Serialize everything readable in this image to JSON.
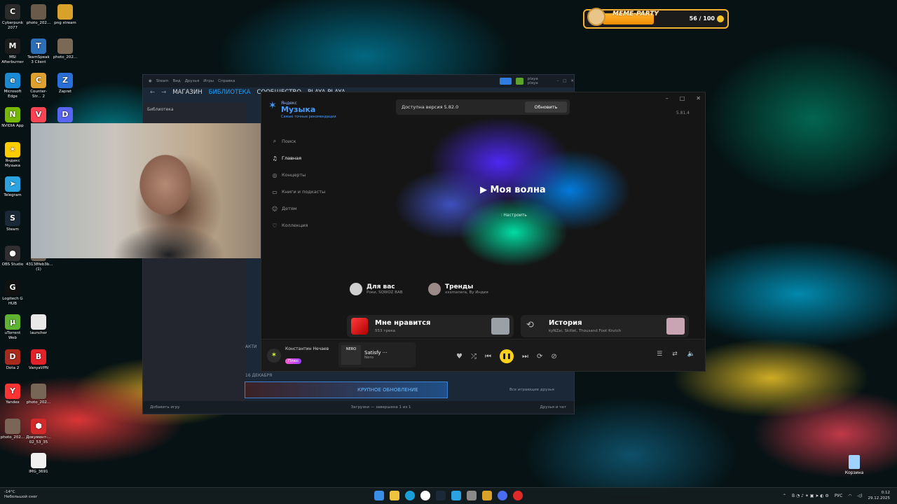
{
  "desktop_icons": [
    {
      "label": "Cyberpunk 2077",
      "color": "#2b2b2b",
      "glyph": "C"
    },
    {
      "label": "photo_202...",
      "color": "#6a5a4a",
      "glyph": ""
    },
    {
      "label": "png stream",
      "color": "#d8a12a",
      "glyph": ""
    },
    {
      "label": "MSI Afterburner",
      "color": "#1c1c1c",
      "glyph": "M"
    },
    {
      "label": "TeamSpeak 3 Client",
      "color": "#2d6fb7",
      "glyph": "T"
    },
    {
      "label": "photo_202...",
      "color": "#7a6a55",
      "glyph": ""
    },
    {
      "label": "Microsoft Edge",
      "color": "#1a8ad4",
      "glyph": "e"
    },
    {
      "label": "Counter-Str... 2",
      "color": "#e0a030",
      "glyph": "C"
    },
    {
      "label": "Zapret",
      "color": "#2a6ed8",
      "glyph": "Z"
    },
    {
      "label": "NVIDIA App",
      "color": "#76b900",
      "glyph": "N"
    },
    {
      "label": "Valorant",
      "color": "#fa4454",
      "glyph": "V"
    },
    {
      "label": "Discord",
      "color": "#5865f2",
      "glyph": "D"
    },
    {
      "label": "Яндекс Музыка",
      "color": "#ffcc00",
      "glyph": "✶"
    },
    {
      "label": "Telegram",
      "color": "#2aa3e0",
      "glyph": "➤"
    },
    {
      "label": "Steam",
      "color": "#1b2838",
      "glyph": "S"
    },
    {
      "label": "OBS Studio",
      "color": "#302e31",
      "glyph": "●"
    },
    {
      "label": "43138feb3b... (1)",
      "color": "#6b5d50",
      "glyph": ""
    },
    {
      "label": "Logitech G HUB",
      "color": "#111111",
      "glyph": "G"
    },
    {
      "label": "uTorrent Web",
      "color": "#5fb332",
      "glyph": "µ"
    },
    {
      "label": "launcher",
      "color": "#e8e8e8",
      "glyph": ""
    },
    {
      "label": "Dota 2",
      "color": "#a82a1c",
      "glyph": "D"
    },
    {
      "label": "VanyaVPN",
      "color": "#e3212a",
      "glyph": "B"
    },
    {
      "label": "Yandex",
      "color": "#ff3333",
      "glyph": "Y"
    },
    {
      "label": "photo_202...",
      "color": "#776655",
      "glyph": ""
    },
    {
      "label": "photo_202...",
      "color": "#7a6556",
      "glyph": ""
    },
    {
      "label": "Документ-... 02_53_35",
      "color": "#d42a2a",
      "glyph": "⬢"
    },
    {
      "label": "IMG_3691",
      "color": "#f0f0f0",
      "glyph": ""
    }
  ],
  "recycle_bin": {
    "label": "Корзина"
  },
  "meme_party": {
    "title": "MEME-PARTY",
    "count": "56 / 100",
    "progress": 0.56
  },
  "steam": {
    "title": "Steam",
    "menu": [
      "Вид",
      "Друзья",
      "Игры",
      "Справка"
    ],
    "user": "playa playa",
    "nav": [
      "МАГАЗИН",
      "БИБЛИОТЕКА",
      "СООБЩЕСТВО",
      "PLAYA PLAYA"
    ],
    "library_label": "Библиотека",
    "date_label": "16 ДЕКАБРЯ",
    "update_banner": "КРУПНОЕ ОБНОВЛЕНИЕ",
    "section_partial": "АКТИ",
    "footer": {
      "add_game": "Добавить игру",
      "downloads": "Загрузки — завершена 1 из 1",
      "friends": "Друзья и чат",
      "all_friends": "Все играющие друзья"
    }
  },
  "yandex_music": {
    "logo_top": "Яндекс",
    "logo_main": "Музыка",
    "logo_tagline": "Самые точные рекомендации",
    "update_notice": "Доступна версия 5.82.0",
    "update_button": "Обновить",
    "version": "5.81.4",
    "menu": [
      {
        "label": "Поиск",
        "icon": "search-icon",
        "glyph": "⌕"
      },
      {
        "label": "Главная",
        "icon": "home-icon",
        "glyph": "♫"
      },
      {
        "label": "Концерты",
        "icon": "concert-icon",
        "glyph": "◎"
      },
      {
        "label": "Книги и подкасты",
        "icon": "book-icon",
        "glyph": "▭"
      },
      {
        "label": "Детям",
        "icon": "kids-icon",
        "glyph": "☺"
      },
      {
        "label": "Коллекция",
        "icon": "heart-icon",
        "glyph": "♡"
      }
    ],
    "wave_title": "Моя волна",
    "wave_tune": "Настроить",
    "for_you": {
      "title": "Для вас",
      "subtitle": "Роки, SQWOZ BAB"
    },
    "trends": {
      "title": "Тренды",
      "subtitle": "xxxmanera, By Индия"
    },
    "liked": {
      "title": "Мне нравится",
      "subtitle": "553 трека"
    },
    "history": {
      "title": "История",
      "subtitle": "kyNZai, Skillet, Thousand Foot Krutch"
    },
    "user": {
      "name": "Константин Нечаев",
      "plus": "Плюс"
    },
    "track": {
      "title": "Satisfy",
      "artist": "Nero",
      "cover_text": "NERO"
    }
  },
  "taskbar": {
    "weather_temp": "-14°C",
    "weather_desc": "Небольшой снег",
    "lang": "РУС",
    "time": "0:12",
    "date": "29.12.2025"
  }
}
